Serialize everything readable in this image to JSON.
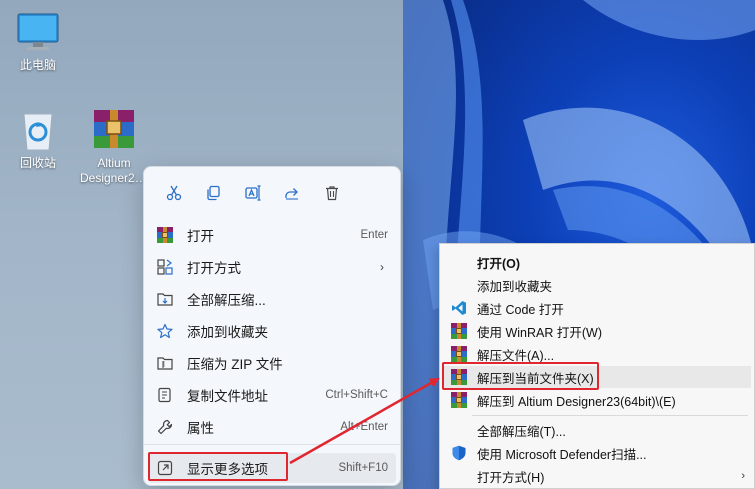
{
  "desktop": {
    "icons": [
      {
        "label": "此电脑",
        "icon": "computer-icon"
      },
      {
        "label": "回收站",
        "icon": "recycle-bin-icon"
      },
      {
        "label_line1": "Altium",
        "label_line2": "Designer2…",
        "icon": "winrar-archive-icon"
      }
    ]
  },
  "context_menu": {
    "toolbar": [
      {
        "name": "cut-icon"
      },
      {
        "name": "copy-icon"
      },
      {
        "name": "rename-icon"
      },
      {
        "name": "share-icon"
      },
      {
        "name": "delete-icon"
      }
    ],
    "items": [
      {
        "label": "打开",
        "shortcut": "Enter",
        "icon": "winrar-icon"
      },
      {
        "label": "打开方式",
        "shortcut": "",
        "icon": "open-with-icon",
        "submenu": true
      },
      {
        "label": "全部解压缩...",
        "shortcut": "",
        "icon": "extract-all-icon"
      },
      {
        "label": "添加到收藏夹",
        "shortcut": "",
        "icon": "star-icon"
      },
      {
        "label": "压缩为 ZIP 文件",
        "shortcut": "",
        "icon": "zip-icon"
      },
      {
        "label": "复制文件地址",
        "shortcut": "Ctrl+Shift+C",
        "icon": "copy-path-icon"
      },
      {
        "label": "属性",
        "shortcut": "Alt+Enter",
        "icon": "properties-icon"
      },
      {
        "label": "显示更多选项",
        "shortcut": "Shift+F10",
        "icon": "more-options-icon"
      }
    ],
    "submenu_arrow": "›"
  },
  "classic_menu": {
    "items": [
      {
        "label": "打开(O)",
        "bold": true,
        "icon": ""
      },
      {
        "label": "添加到收藏夹",
        "icon": ""
      },
      {
        "label": "通过 Code 打开",
        "icon": "vscode-icon"
      },
      {
        "label": "使用 WinRAR 打开(W)",
        "icon": "winrar-icon"
      },
      {
        "label": "解压文件(A)...",
        "icon": "winrar-icon"
      },
      {
        "label": "解压到当前文件夹(X)",
        "icon": "winrar-icon"
      },
      {
        "label": "解压到 Altium Designer23(64bit)\\(E)",
        "icon": "winrar-icon"
      },
      {
        "label": "全部解压缩(T)...",
        "icon": ""
      },
      {
        "label": "使用 Microsoft Defender扫描...",
        "icon": "defender-shield-icon"
      },
      {
        "label": "打开方式(H)",
        "icon": "",
        "submenu": true
      }
    ],
    "submenu_arrow": "›"
  },
  "colors": {
    "highlight_box": "#e0262f",
    "arrow": "#e0262f"
  }
}
